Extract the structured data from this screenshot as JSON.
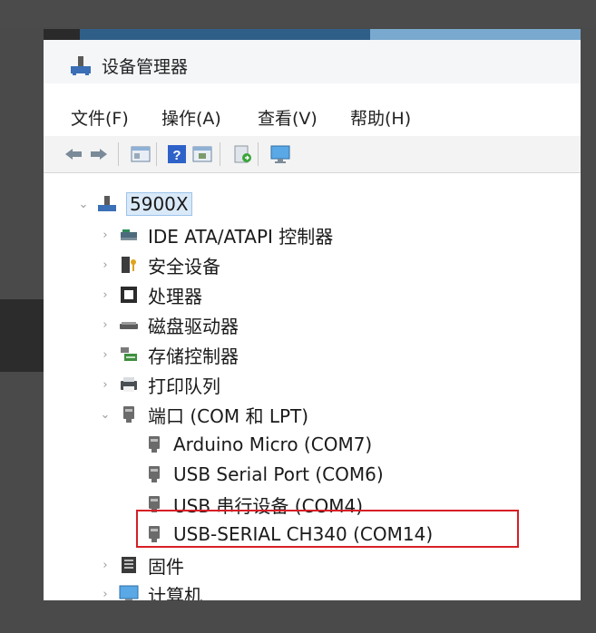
{
  "window": {
    "title": "设备管理器"
  },
  "menu": [
    {
      "label": "文件(F)"
    },
    {
      "label": "操作(A)"
    },
    {
      "label": "查看(V)"
    },
    {
      "label": "帮助(H)"
    }
  ],
  "toolbar": [
    {
      "icon": "back-arrow-icon"
    },
    {
      "icon": "forward-arrow-icon"
    },
    {
      "icon": "properties-icon"
    },
    {
      "icon": "help-icon"
    },
    {
      "icon": "update-driver-icon"
    },
    {
      "icon": "enable-device-icon"
    },
    {
      "icon": "monitor-icon"
    }
  ],
  "tree": {
    "root": {
      "label": "5900X",
      "expanded": true
    },
    "categories": [
      {
        "label": "IDE ATA/ATAPI 控制器",
        "icon": "ide-controller-icon"
      },
      {
        "label": "安全设备",
        "icon": "security-device-icon"
      },
      {
        "label": "处理器",
        "icon": "processor-icon"
      },
      {
        "label": "磁盘驱动器",
        "icon": "disk-drive-icon"
      },
      {
        "label": "存储控制器",
        "icon": "storage-controller-icon"
      },
      {
        "label": "打印队列",
        "icon": "print-queue-icon"
      },
      {
        "label": "端口 (COM 和 LPT)",
        "icon": "port-icon",
        "expanded": true
      },
      {
        "label": "固件",
        "icon": "firmware-icon"
      },
      {
        "label": "计算机",
        "icon": "computer-icon"
      }
    ],
    "ports": [
      {
        "label": "Arduino Micro (COM7)"
      },
      {
        "label": "USB Serial Port (COM6)"
      },
      {
        "label": "USB 串行设备 (COM4)"
      },
      {
        "label": "USB-SERIAL CH340 (COM14)",
        "highlighted": true
      }
    ]
  },
  "colors": {
    "highlight": "#d61f26",
    "selection": "#d9e9f8",
    "frame": "#4a4a4a"
  }
}
